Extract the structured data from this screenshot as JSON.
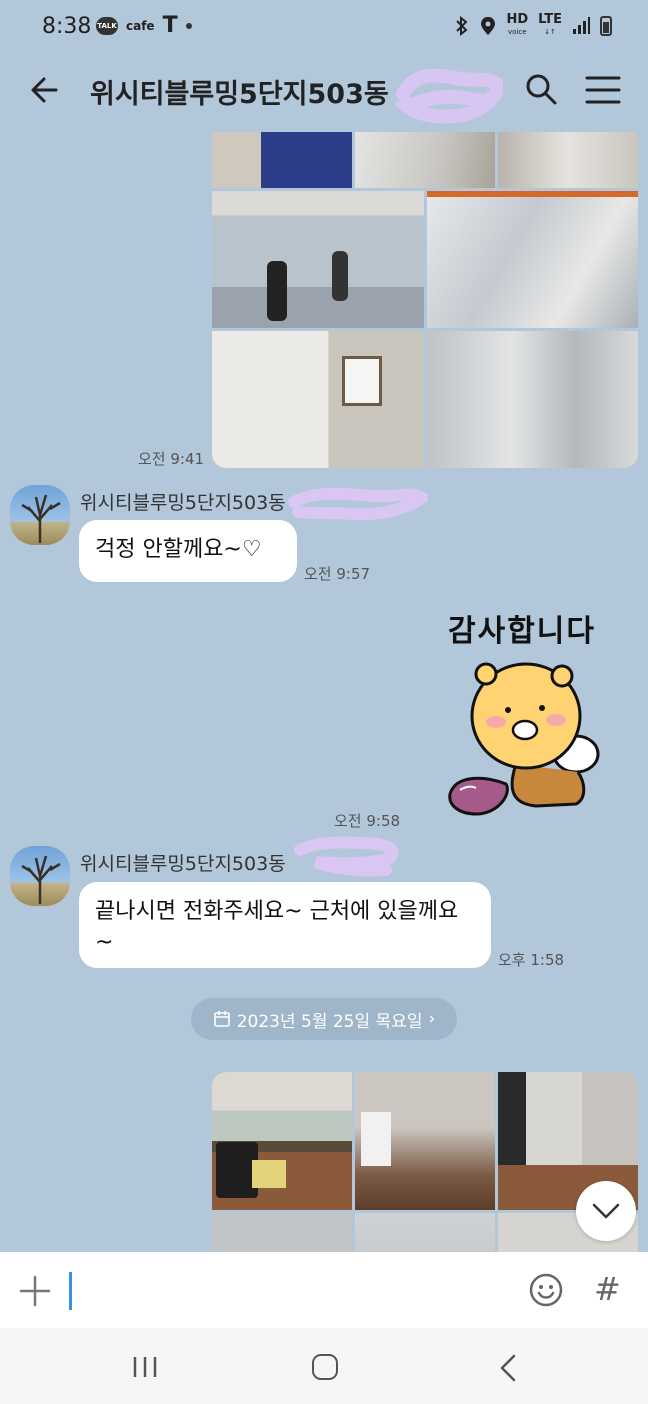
{
  "status_bar": {
    "time": "8:38",
    "talk_badge": "TALK",
    "cafe": "cafe",
    "t_icon": "T",
    "hd": "HD",
    "hd_sub": "voice",
    "lte": "LTE"
  },
  "header": {
    "title": "위시티블루밍5단지503동"
  },
  "messages": {
    "m1": {
      "time": "오전 9:41"
    },
    "m2": {
      "sender": "위시티블루밍5단지503동",
      "text": "걱정 안할께요~♡",
      "time": "오전 9:57"
    },
    "m3": {
      "sticker_text": "감사합니다",
      "time": "오전 9:58"
    },
    "m4": {
      "sender": "위시티블루밍5단지503동",
      "text": "끝나시면 전화주세요~ 근처에 있을께요~",
      "time": "오후 1:58"
    },
    "date_divider": "2023년 5월 25일 목요일"
  },
  "input": {
    "hash": "#"
  },
  "colors": {
    "chat_bg": "#b2c7da",
    "bubble": "#ffffff",
    "caret": "#3a8ee6",
    "date_pill": "#9fb5c9"
  }
}
